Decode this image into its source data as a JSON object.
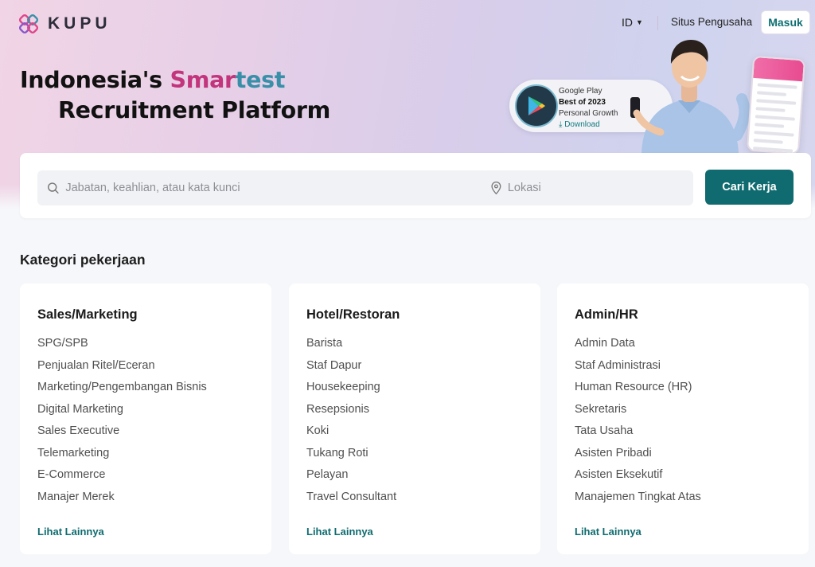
{
  "header": {
    "brand": "KUPU",
    "language": "ID",
    "employer_link": "Situs Pengusaha",
    "login_label": "Masuk"
  },
  "hero": {
    "headline_part1": "Indonesia's ",
    "headline_highlight_a": "Smar",
    "headline_highlight_b": "test",
    "headline_line2": "Recruitment Platform",
    "badge": {
      "line1": "Google Play",
      "line2": "Best of 2023",
      "line3": "Personal Growth",
      "line4": "Download"
    }
  },
  "search": {
    "keyword_placeholder": "Jabatan, keahlian, atau kata kunci",
    "keyword_value": "",
    "location_placeholder": "Lokasi",
    "location_value": "",
    "button_label": "Cari Kerja"
  },
  "categories": {
    "title": "Kategori pekerjaan",
    "more_label": "Lihat Lainnya",
    "groups": [
      {
        "name": "Sales/Marketing",
        "items": [
          "SPG/SPB",
          "Penjualan Ritel/Eceran",
          "Marketing/Pengembangan Bisnis",
          "Digital Marketing",
          "Sales Executive",
          "Telemarketing",
          "E-Commerce",
          "Manajer Merek"
        ]
      },
      {
        "name": "Hotel/Restoran",
        "items": [
          "Barista",
          "Staf Dapur",
          "Housekeeping",
          "Resepsionis",
          "Koki",
          "Tukang Roti",
          "Pelayan",
          "Travel Consultant"
        ]
      },
      {
        "name": "Admin/HR",
        "items": [
          "Admin Data",
          "Staf Administrasi",
          "Human Resource (HR)",
          "Sekretaris",
          "Tata Usaha",
          "Asisten Pribadi",
          "Asisten Eksekutif",
          "Manajemen Tingkat Atas"
        ]
      }
    ]
  },
  "colors": {
    "accent": "#0f6b6f",
    "highlight_pink": "#c2357c",
    "highlight_teal": "#3a8fa8"
  },
  "icons": {
    "logo": "kupu-butterfly-logo",
    "caret": "caret-down-icon",
    "search": "search-icon",
    "location": "location-pin-icon",
    "download": "download-icon",
    "google_play": "google-play-icon"
  }
}
